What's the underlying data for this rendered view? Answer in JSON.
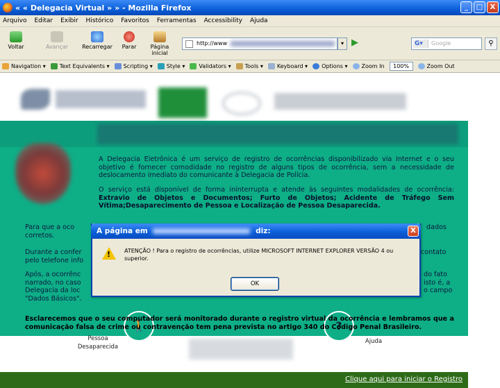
{
  "window": {
    "title": "« « Delegacia Virtual » » - Mozilla Firefox",
    "minimize": "_",
    "maximize": "□",
    "close": "X"
  },
  "menu": [
    "Arquivo",
    "Editar",
    "Exibir",
    "Histórico",
    "Favoritos",
    "Ferramentas",
    "Accessibility",
    "Ajuda"
  ],
  "nav": {
    "back": "Voltar",
    "forward": "Avançar",
    "reload": "Recarregar",
    "stop": "Parar",
    "home": "Página inicial",
    "url": "http://www",
    "search_placeholder": "Google"
  },
  "devbar": {
    "items": [
      "Navigation ▾",
      "Text Equivalents ▾",
      "Scripting ▾",
      "Style ▾",
      "Validators ▾",
      "Tools ▾",
      "Keyboard ▾",
      "Options ▾"
    ],
    "zoom_in": "Zoom In",
    "zoom_level": "100%",
    "zoom_out": "Zoom Out"
  },
  "page": {
    "para1": "A Delegacia Eletrônica é um serviço de registro de ocorrências disponibilizado via Internet e o seu objetivo é fornecer comodidade no registro de alguns tipos de ocorrência, sem a necessidade de deslocamento imediato do comunicante à Delegacia de Polícia.",
    "para2_lead": "O serviço está disponível de forma ininterrupta e atende às seguintes modalidades de ocorrência: ",
    "para2_bold": "Extravio de Objetos e Documentos; Furto de Objetos; Acidente de Tráfego Sem Vítima;Desaparecimento de Pessoa e Localização de Pessoa Desaparecida.",
    "left1": "Para que a oco",
    "left1b": "corretos.",
    "right1": "dados",
    "left2": "Durante a confer",
    "left2b": "pelo telefone info",
    "right2": "contato",
    "left3": "Após, a ocorrênc",
    "left3b": "narrado, no caso",
    "left3c": "Delegacia da loc",
    "left3d": "\"Dados Básicos\".",
    "right3": "do fato",
    "right3b": "isto é, a",
    "right3c": "o campo",
    "warning": "Esclarecemos que o seu computador será monitorado durante o registro virtual da ocorrência e lembramos que a comunicação falsa de crime ou contravenção tem pena prevista no artigo 340 do Código Penal Brasileiro.",
    "link_pessoa": "Pessoa",
    "link_desaparecida": "Desaparecida",
    "link_ajuda": "Ajuda",
    "footer_link": "Clique aqui para iniciar o Registro"
  },
  "dialog": {
    "title_prefix": "A página em",
    "title_suffix": "diz:",
    "message": "ATENÇÃO ! Para o registro de ocorrências, utilize MICROSOFT INTERNET EXPLORER VERSÃO 4 ou superior.",
    "ok": "OK",
    "close": "X"
  },
  "colors": {
    "page_green": "#0eae87",
    "footer_green": "#2e6b18",
    "xp_blue": "#0a5fd8"
  }
}
